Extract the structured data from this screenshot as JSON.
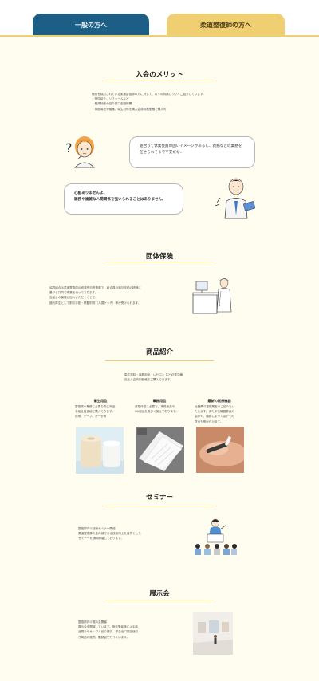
{
  "tabs": {
    "general": "一般の方へ",
    "judo": "柔道整復師の方へ"
  },
  "benefits": {
    "title": "入会のメリット",
    "intro": "開業を検討されている柔道整復師の方に対して、以下の特典についてご紹介しています。",
    "items": [
      "・物件紹介、リフォームなど",
      "・融資制度の紹介窓口金融機関",
      "・事務用品や機器、衛生材料を購入会員特別価格で購入可"
    ],
    "bubble_worry": "組合って休業会員の固いイメージがあるし、雑務などの業務を任せられそうで不安だな…",
    "bubble_answer_line1": "心配ありませんよ。",
    "bubble_answer_line2": "雑務や複雑な人間関係を強いられることはありません。"
  },
  "insurance": {
    "title": "団体保険",
    "lines": [
      "協同組合は柔道整復師の経済的自営基盤で、組合員の相互扶助の精神に",
      "基づき共同で事業を行っております。",
      "自組合の保険に加入いただくことで、",
      "福利厚生として割引手配・積載財物（人損ケッヂ）等が受けられます。"
    ]
  },
  "products": {
    "title": "商品紹介",
    "intro_line1": "衛生材料・事務用品・レセコン など必要な備",
    "intro_line2": "品を入会特別価格でご購入できます。",
    "items": [
      {
        "title": "衛生用品",
        "desc": [
          "整復院の業務に必要な衛生商品",
          "を組合員価格で購入できます。",
          "包帯、テープ、ガーゼ等"
        ]
      },
      {
        "title": "事務用品",
        "desc": [
          "書類作成に必要な、事務用品や",
          "OA用品を数多く揃えております。"
        ]
      },
      {
        "title": "最新の医療機器",
        "desc": [
          "近畿県の整復業者のご紹介をい",
          "たします。また中古機器業者の",
          "紹介や、機器によってはデモの",
          "貸出も受け付けます。"
        ]
      }
    ]
  },
  "seminar": {
    "title": "セミナー",
    "lines": [
      "整復師向け技術セミナー開催",
      "柔道整復師の生命線である技術向上を目的とした",
      "セミナーを随時開催しております。"
    ]
  },
  "exhibition": {
    "title": "展示会",
    "lines": [
      "整復師向け展示会開催",
      "展示会を開催しています。指定業者様による商",
      "品展示やサンプル品の提供、学会出口限定値引",
      "き商品の販売、勧誘会を行っています。"
    ]
  },
  "colors": {
    "accent": "#f0cf72",
    "navy": "#1d5e86",
    "background": "#fffcf0"
  }
}
